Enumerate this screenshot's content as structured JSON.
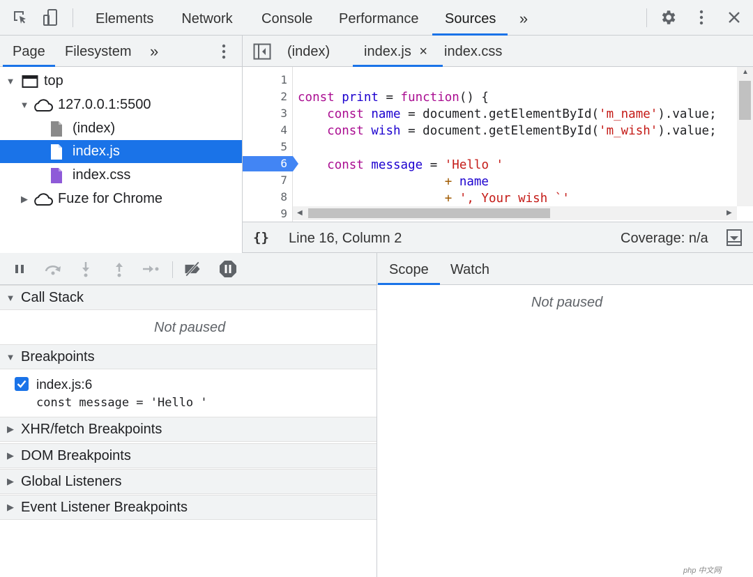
{
  "toolbar": {
    "tabs": [
      "Elements",
      "Network",
      "Console",
      "Performance",
      "Sources"
    ],
    "active_tab": "Sources",
    "more": "»",
    "icons": [
      "inspect-icon",
      "device-toolbar-icon",
      "more-tabs-icon",
      "settings-icon",
      "more-options-icon",
      "close-icon"
    ]
  },
  "navigator": {
    "tabs": [
      "Page",
      "Filesystem"
    ],
    "more": "»",
    "tree": [
      {
        "label": "top",
        "icon": "frame-icon"
      },
      {
        "label": "127.0.0.1:5500",
        "icon": "cloud-icon"
      },
      {
        "label": "(index)",
        "icon": "document-icon"
      },
      {
        "label": "index.js",
        "icon": "script-file-icon"
      },
      {
        "label": "index.css",
        "icon": "stylesheet-file-icon"
      },
      {
        "label": "Fuze for Chrome",
        "icon": "cloud-icon"
      }
    ]
  },
  "editor": {
    "tabs": [
      "(index)",
      "index.js",
      "index.css"
    ],
    "active_tab": "index.js",
    "close_glyph": "×",
    "line_numbers": [
      "1",
      "2",
      "3",
      "4",
      "5",
      "6",
      "7",
      "8",
      "9"
    ],
    "breakpoint_line": "6",
    "status": {
      "format_icon": "{}",
      "position": "Line 16, Column 2",
      "coverage": "Coverage: n/a"
    }
  },
  "debugger": {
    "icons": [
      "pause-icon",
      "step-over-icon",
      "step-into-icon",
      "step-out-icon",
      "step-icon",
      "deactivate-breakpoints-icon",
      "pause-on-exceptions-icon"
    ],
    "sections": {
      "call_stack": "Call Stack",
      "breakpoints": "Breakpoints",
      "xhr": "XHR/fetch Breakpoints",
      "dom": "DOM Breakpoints",
      "global": "Global Listeners",
      "event": "Event Listener Breakpoints"
    },
    "not_paused": "Not paused",
    "breakpoint_item": {
      "location": "index.js:6",
      "code": "const message = 'Hello '",
      "checked": true
    }
  },
  "scope": {
    "tabs": [
      "Scope",
      "Watch"
    ],
    "not_paused": "Not paused"
  },
  "colors": {
    "accent": "#1a73e8",
    "keyword": "#aa0d91",
    "variable": "#1c00cf",
    "string": "#c41a16"
  },
  "watermark": "php 中文网"
}
